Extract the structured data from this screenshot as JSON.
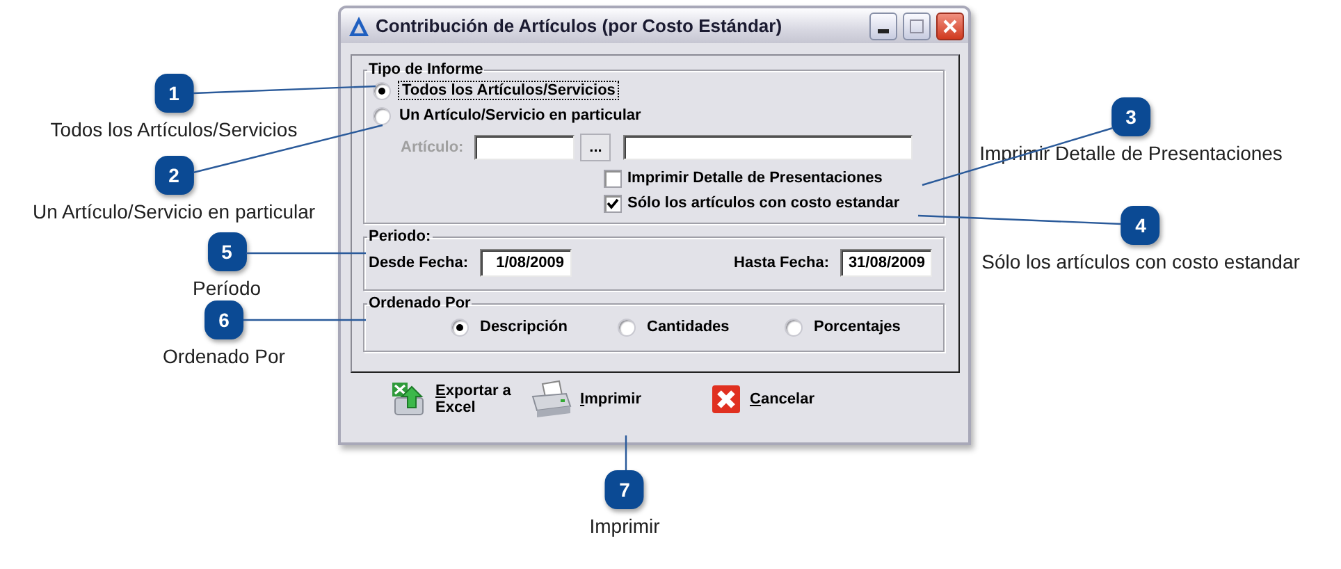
{
  "window": {
    "title": "Contribución de Artículos (por Costo Estándar)"
  },
  "tipo_de_informe": {
    "title": "Tipo de Informe",
    "options": [
      {
        "label": "Todos los Artículos/Servicios",
        "selected": true,
        "focused": true
      },
      {
        "label": "Un Artículo/Servicio en particular",
        "selected": false,
        "focused": false
      }
    ],
    "articulo": {
      "label": "Artículo:",
      "disabled": true,
      "browse": "..."
    },
    "checkboxes": [
      {
        "label": "Imprimir Detalle de Presentaciones",
        "checked": false
      },
      {
        "label": "Sólo los artículos con costo estandar",
        "checked": true
      }
    ]
  },
  "periodo": {
    "title": "Periodo:",
    "fields": [
      {
        "label": "Desde Fecha:",
        "value": "1/08/2009"
      },
      {
        "label": "Hasta Fecha:",
        "value": "31/08/2009"
      }
    ]
  },
  "ordenado_por": {
    "title": "Ordenado Por",
    "options": [
      {
        "label": "Descripción",
        "selected": true
      },
      {
        "label": "Cantidades",
        "selected": false
      },
      {
        "label": "Porcentajes",
        "selected": false
      }
    ]
  },
  "buttons": [
    {
      "kind": "excel",
      "label": "Exportar a Excel"
    },
    {
      "kind": "print",
      "label": "Imprimir"
    },
    {
      "kind": "cancel",
      "label": "Cancelar"
    }
  ],
  "callouts": [
    {
      "number": "1",
      "text": "Todos los Artículos/Servicios"
    },
    {
      "number": "2",
      "text": "Un Artículo/Servicio en particular"
    },
    {
      "number": "3",
      "text": "Imprimir Detalle de Presentaciones"
    },
    {
      "number": "4",
      "text": "Sólo los artículos con costo estandar"
    },
    {
      "number": "5",
      "text": "Período"
    },
    {
      "number": "6",
      "text": "Ordenado Por"
    },
    {
      "number": "7",
      "text": "Imprimir"
    }
  ]
}
